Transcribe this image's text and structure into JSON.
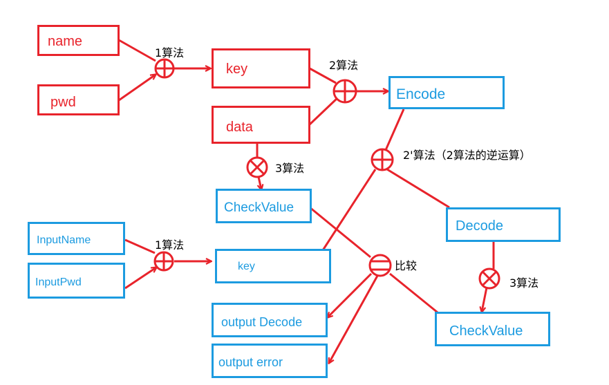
{
  "boxes": {
    "name": "name",
    "pwd": "pwd",
    "key_top": "key",
    "data": "data",
    "encode": "Encode",
    "checkvalue_left": "CheckValue",
    "decode": "Decode",
    "input_name": "InputName",
    "input_pwd": "InputPwd",
    "key_bottom": "key",
    "checkvalue_right": "CheckValue",
    "output_decode": "output Decode",
    "output_error": "output error"
  },
  "labels": {
    "algo1_top": "1算法",
    "algo2": "2算法",
    "algo3_left": "3算法",
    "algo2_inverse": "2'算法（2算法的逆运算）",
    "algo1_bottom": "1算法",
    "compare": "比较",
    "algo3_right": "3算法"
  },
  "colors": {
    "red": "#e8232b",
    "blue": "#1c9be0"
  }
}
